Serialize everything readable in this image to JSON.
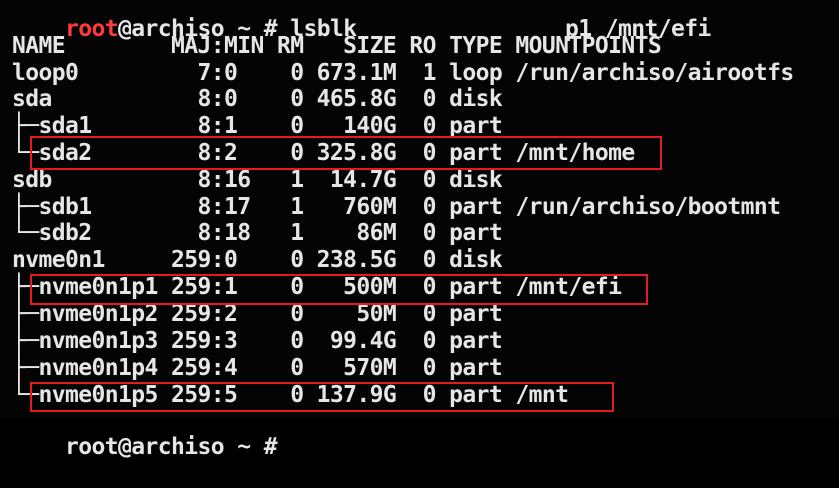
{
  "terminal": {
    "top_fragment": "root@archiso ~ # lsblk",
    "prompt_user": "root",
    "prompt_host": "@archiso ~ #",
    "command": "lsblk",
    "clipped_right": "p1 /mnt/efi",
    "header": "NAME        MAJ:MIN RM   SIZE RO TYPE MOUNTPOINTS",
    "rows": [
      {
        "text": "loop0         7:0    0 673.1M  1 loop /run/archiso/airootfs",
        "highlight": false
      },
      {
        "text": "sda           8:0    0 465.8G  0 disk",
        "highlight": false
      },
      {
        "text": "├─sda1        8:1    0   140G  0 part",
        "highlight": false
      },
      {
        "text": "└─sda2        8:2    0 325.8G  0 part /mnt/home",
        "highlight": true
      },
      {
        "text": "sdb           8:16   1  14.7G  0 disk",
        "highlight": false
      },
      {
        "text": "├─sdb1        8:17   1   760M  0 part /run/archiso/bootmnt",
        "highlight": false
      },
      {
        "text": "└─sdb2        8:18   1    86M  0 part",
        "highlight": false
      },
      {
        "text": "nvme0n1     259:0    0 238.5G  0 disk",
        "highlight": false
      },
      {
        "text": "├─nvme0n1p1 259:1    0   500M  0 part /mnt/efi",
        "highlight": true
      },
      {
        "text": "├─nvme0n1p2 259:2    0    50M  0 part",
        "highlight": false
      },
      {
        "text": "├─nvme0n1p3 259:3    0  99.4G  0 part",
        "highlight": false
      },
      {
        "text": "├─nvme0n1p4 259:4    0   570M  0 part",
        "highlight": false
      },
      {
        "text": "└─nvme0n1p5 259:5    0 137.9G  0 part /mnt",
        "highlight": true
      }
    ],
    "bottom_fragment": "root@archiso ~ #"
  },
  "colors": {
    "background": "#040404",
    "text": "#e6e6e6",
    "prompt_user": "#ff3b3b",
    "highlight_box": "#e21b23"
  }
}
